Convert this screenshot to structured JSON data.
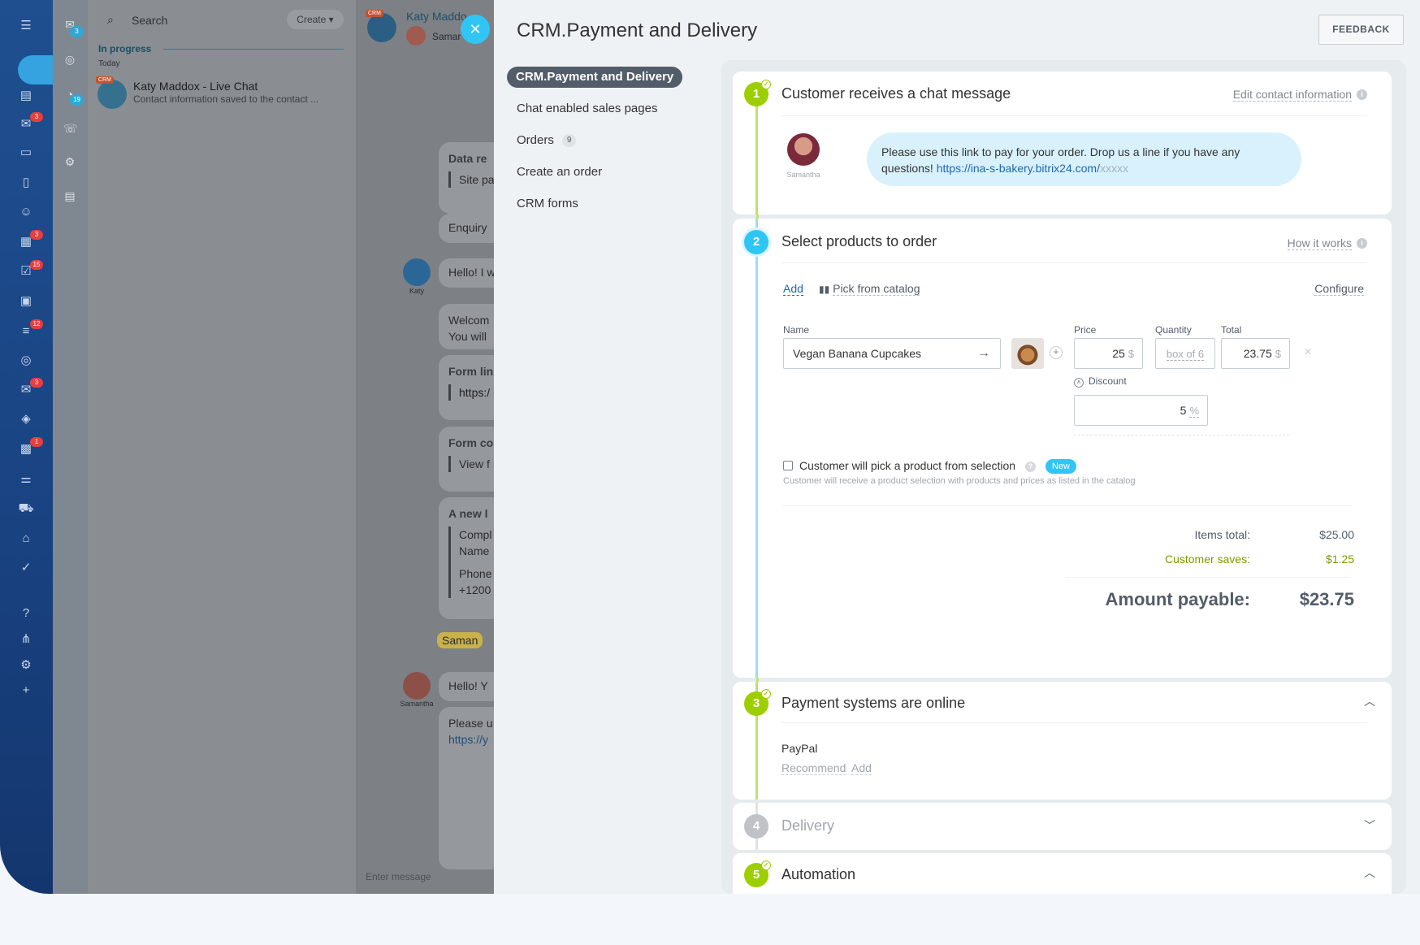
{
  "rail": {
    "badges": [
      "3",
      "3",
      "15",
      "12",
      "3",
      "1"
    ]
  },
  "col2": {
    "badges": [
      "3",
      "19"
    ]
  },
  "chatlist": {
    "search_placeholder": "Search",
    "create_label": "Create",
    "section": "In progress",
    "today": "Today",
    "item_title": "Katy Maddox - Live Chat",
    "item_sub": "Contact information saved to the contact ...",
    "crm_tag": "CRM"
  },
  "chatpane": {
    "title": "Katy Maddo",
    "sub": "Samar",
    "b1_title": "Data re",
    "b1_line": "Site pa",
    "b2": "Enquiry",
    "b3": "Hello! I w",
    "katy_label": "Katy",
    "b4_l1": "Welcom",
    "b4_l2": "You will",
    "b5_title": "Form lin",
    "b5_line": "https:/",
    "b6_title": "Form co",
    "b6_line": "View f",
    "b7_title": "A new l",
    "b7_l1": "Compl",
    "b7_l2": "Name",
    "b7_l3": "Phone",
    "b7_l4": "+1200",
    "samantha_tag": "Saman",
    "b8": "Hello! Y",
    "samantha_label": "Samantha",
    "b9_l1": "Please u",
    "b9_l2": "https://y",
    "enter_placeholder": "Enter message"
  },
  "slider": {
    "title": "CRM.Payment and Delivery",
    "feedback": "FEEDBACK",
    "menu": [
      {
        "label": "CRM.Payment and Delivery"
      },
      {
        "label": "Chat enabled sales pages"
      },
      {
        "label": "Orders",
        "count": "9"
      },
      {
        "label": "Create an order"
      },
      {
        "label": "CRM forms"
      }
    ]
  },
  "step1": {
    "num": "1",
    "heading": "Customer receives a chat message",
    "action": "Edit contact information",
    "avatar_label": "Samantha",
    "message_text": "Please use this link to pay for your order. Drop us a line if you have any questions! ",
    "message_link": "https://ina-s-bakery.bitrix24.com/",
    "message_link_tail": "xxxxx"
  },
  "step2": {
    "num": "2",
    "heading": "Select products to order",
    "action": "How it works",
    "add": "Add",
    "pick": "Pick from catalog",
    "configure": "Configure",
    "name_label": "Name",
    "product_name": "Vegan Banana Cupcakes",
    "price_label": "Price",
    "price": "25",
    "currency": "$",
    "qty_label": "Quantity",
    "qty": "box of 6",
    "total_label": "Total",
    "total": "23.75",
    "discount_label": "Discount",
    "discount": "5",
    "percent": "%",
    "selection_label": "Customer will pick a product from selection",
    "new_badge": "New",
    "selection_hint": "Customer will receive a product selection with products and prices as listed in the catalog",
    "items_total_label": "Items total:",
    "items_total": "$25.00",
    "saves_label": "Customer saves:",
    "saves": "$1.25",
    "payable_label": "Amount payable:",
    "payable": "$23.75"
  },
  "step3": {
    "num": "3",
    "heading": "Payment systems are online",
    "system": "PayPal",
    "recommend": "Recommend",
    "add": "Add"
  },
  "step4": {
    "num": "4",
    "heading": "Delivery"
  },
  "step5": {
    "num": "5",
    "heading": "Automation"
  },
  "colors": {
    "green": "#9dcf00",
    "blue": "#2fc6f6",
    "grey": "#bfc3c7"
  }
}
